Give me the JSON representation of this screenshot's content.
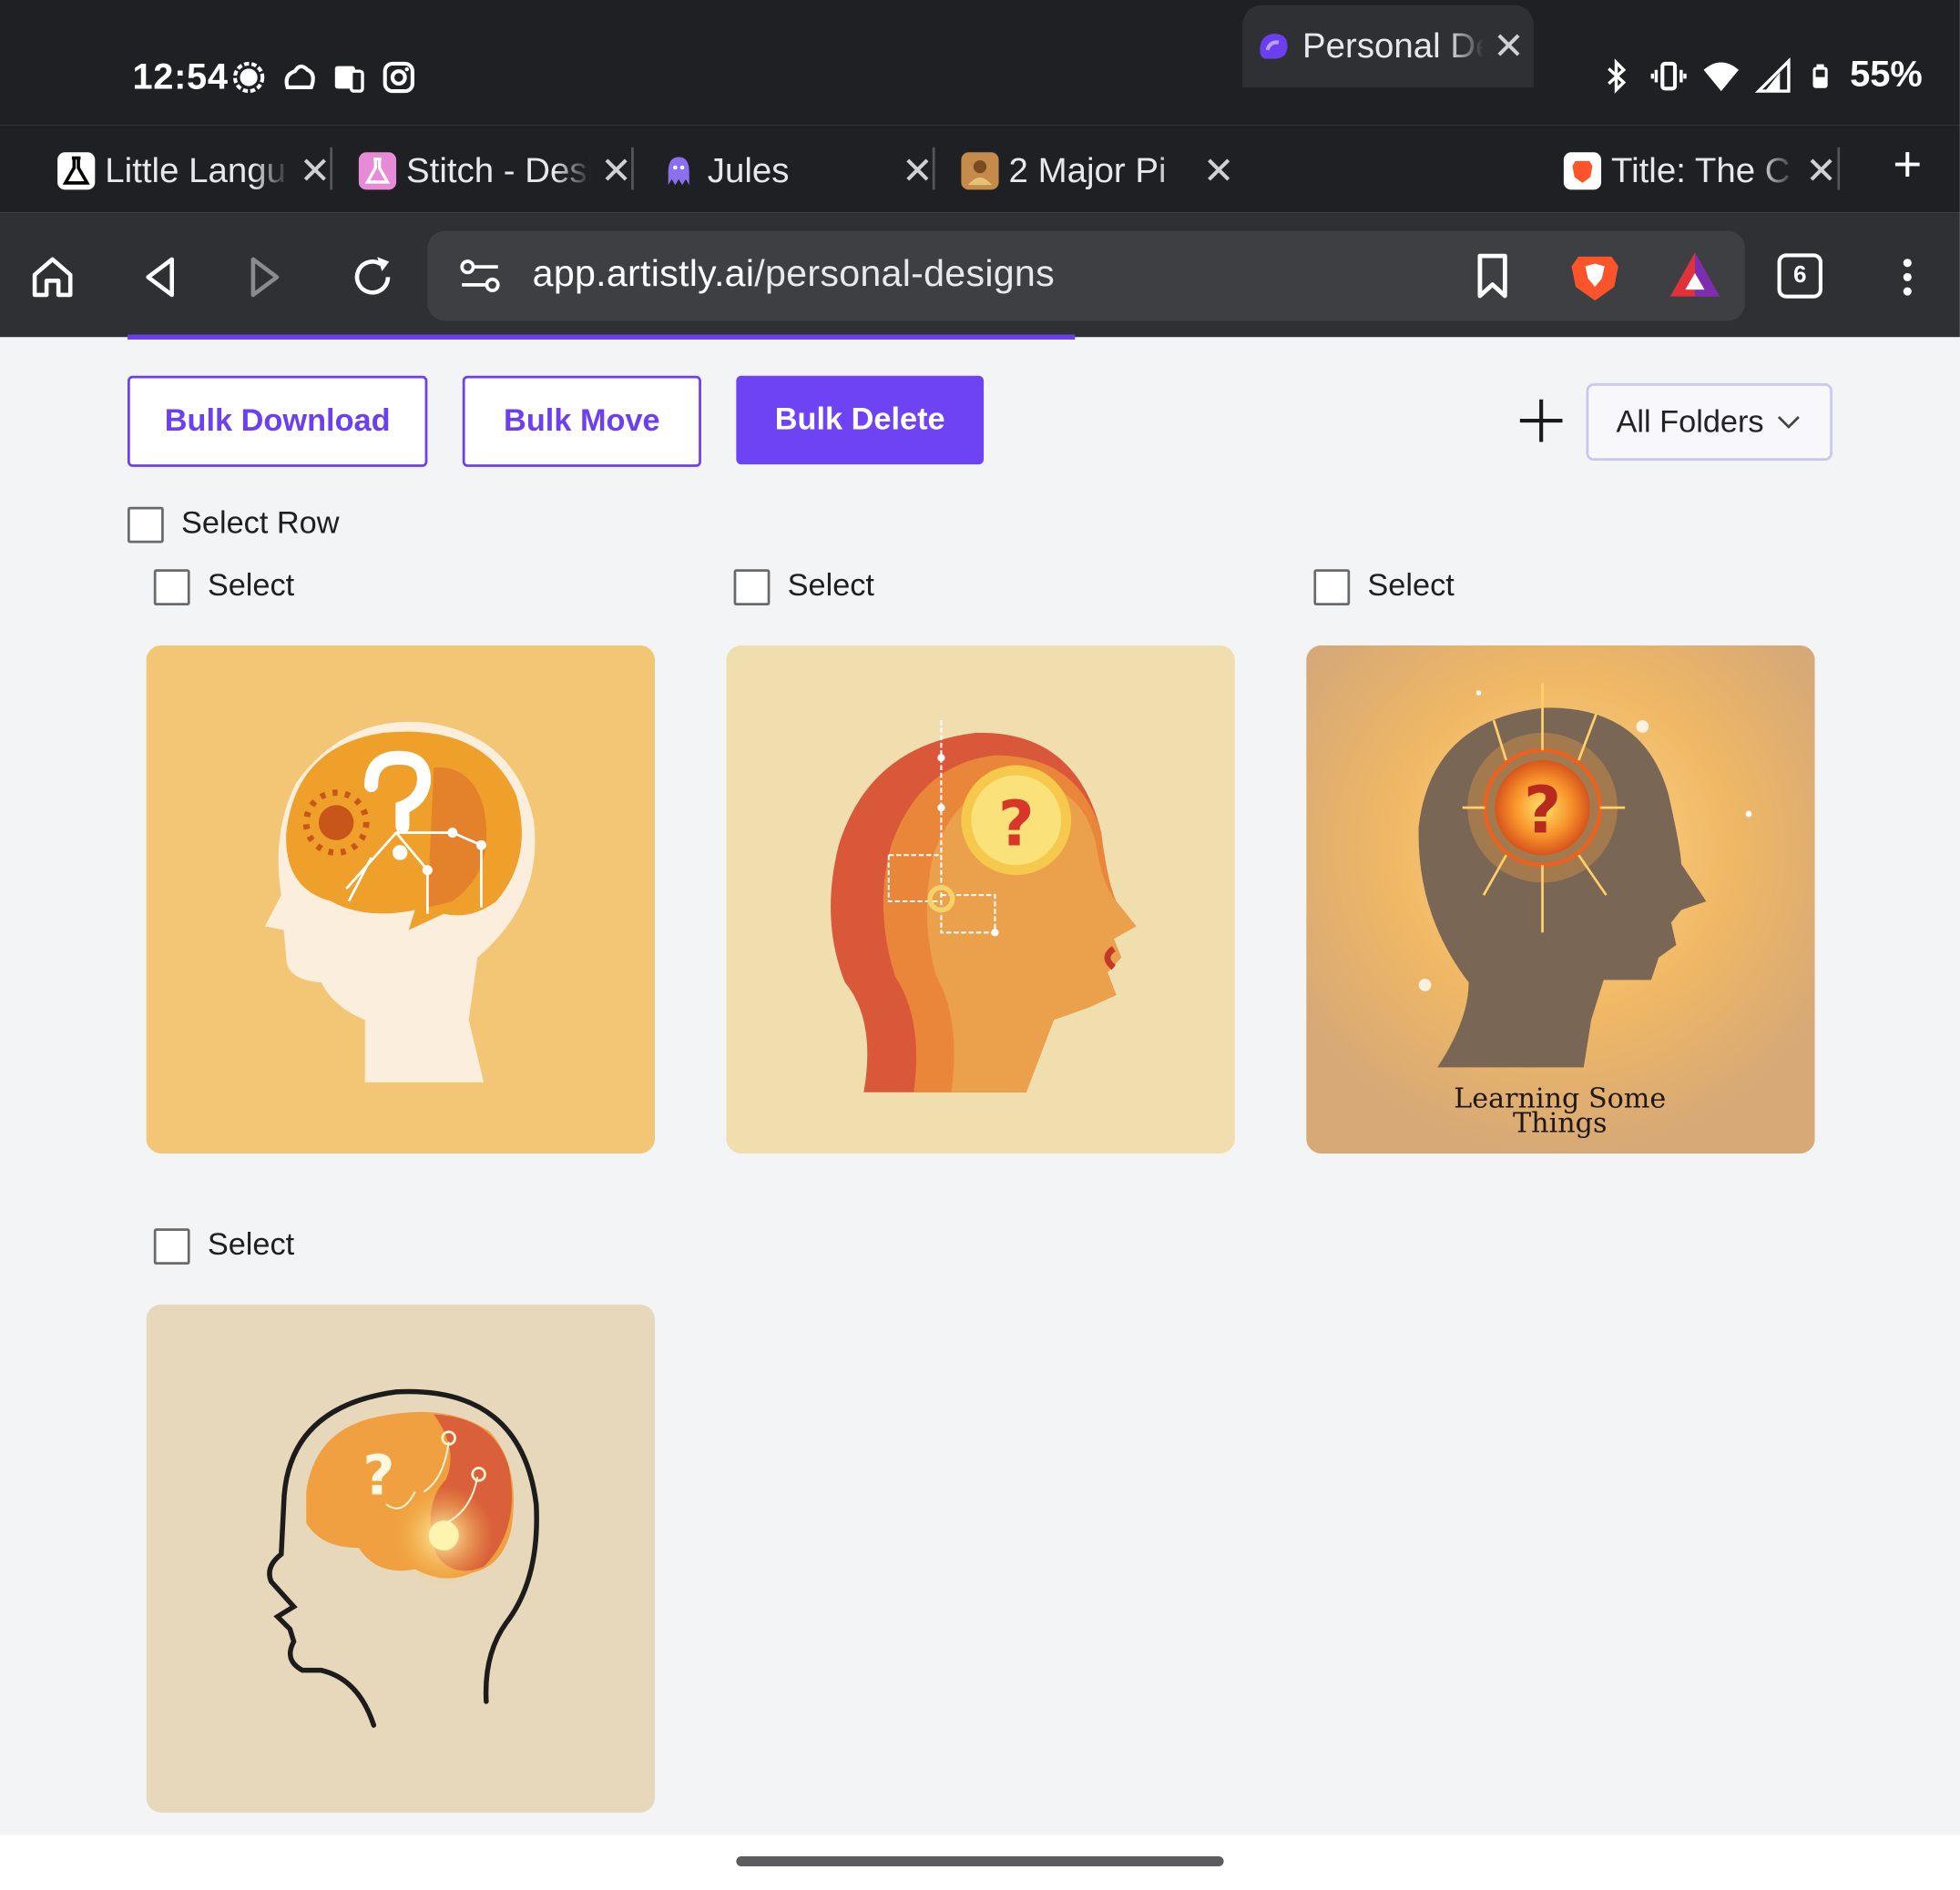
{
  "status_bar": {
    "time": "12:54",
    "battery": "55%",
    "icons_left": [
      "signal-app-icon",
      "cloud-app-icon",
      "devices-icon",
      "instagram-icon"
    ],
    "icons_right": [
      "bluetooth-icon",
      "vibrate-icon",
      "wifi-icon",
      "cell-signal-icon",
      "battery-icon"
    ]
  },
  "tabs": [
    {
      "title": "Little Langu",
      "icon": "flask-icon",
      "active": false
    },
    {
      "title": "Stitch - Desi",
      "icon": "stitch-icon",
      "active": false
    },
    {
      "title": "Jules",
      "icon": "octopus-icon",
      "active": false
    },
    {
      "title": "2 Major Pi",
      "icon": "avatar-icon",
      "active": false
    },
    {
      "title": "Personal De",
      "icon": "artistly-icon",
      "active": true
    },
    {
      "title": "Title: The C",
      "icon": "brave-page-icon",
      "active": false
    }
  ],
  "toolbar": {
    "url_host": "app.artistly.ai",
    "url_path": "/personal-designs",
    "tabs_count": "6"
  },
  "actions": {
    "bulk_download": "Bulk Download",
    "bulk_move": "Bulk Move",
    "bulk_delete": "Bulk Delete"
  },
  "folder_filter": {
    "selected": "All Folders"
  },
  "select_row_label": "Select Row",
  "designs": [
    {
      "select_label": "Select",
      "bg": "#f3c676",
      "caption": ""
    },
    {
      "select_label": "Select",
      "bg": "#f1deae",
      "caption": ""
    },
    {
      "select_label": "Select",
      "bg": "#d6a976",
      "caption_line1": "Learning Some",
      "caption_line2": "Things"
    },
    {
      "select_label": "Select",
      "bg": "#e8d8bb",
      "caption": ""
    }
  ],
  "colors": {
    "accent": "#6d43f3",
    "chrome_dark": "#1f2023",
    "toolbar": "#2f3034",
    "page_bg": "#f3f4f6"
  }
}
